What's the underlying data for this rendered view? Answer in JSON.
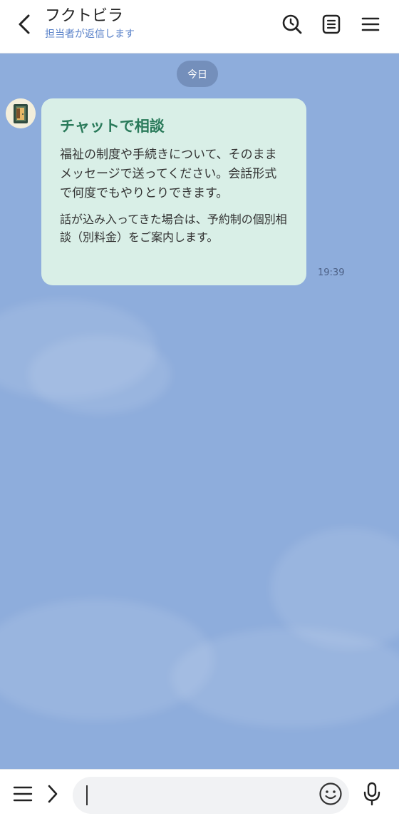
{
  "header": {
    "title": "フクトビラ",
    "subtitle": "担当者が返信します",
    "icons": [
      "back-icon",
      "search-icon",
      "notes-icon",
      "menu-icon"
    ]
  },
  "date_separator": "今日",
  "message": {
    "title": "チャットで相談",
    "body": "福祉の制度や手続きについて、そのままメッセージで送ってください。会話形式で何度でもやりとりできます。",
    "note": "話が込み入ってきた場合は、予約制の個別相談（別料金）をご案内します。",
    "time": "19:39"
  },
  "input_bar": {
    "input_value": "",
    "icons": [
      "menu-icon",
      "chevron-right-icon",
      "emoji-icon",
      "microphone-icon"
    ]
  },
  "colors": {
    "background": "#8eaddc",
    "bubble": "#d9efe7",
    "bubble_title": "#2a7a5a",
    "subtitle": "#5a82c9"
  }
}
